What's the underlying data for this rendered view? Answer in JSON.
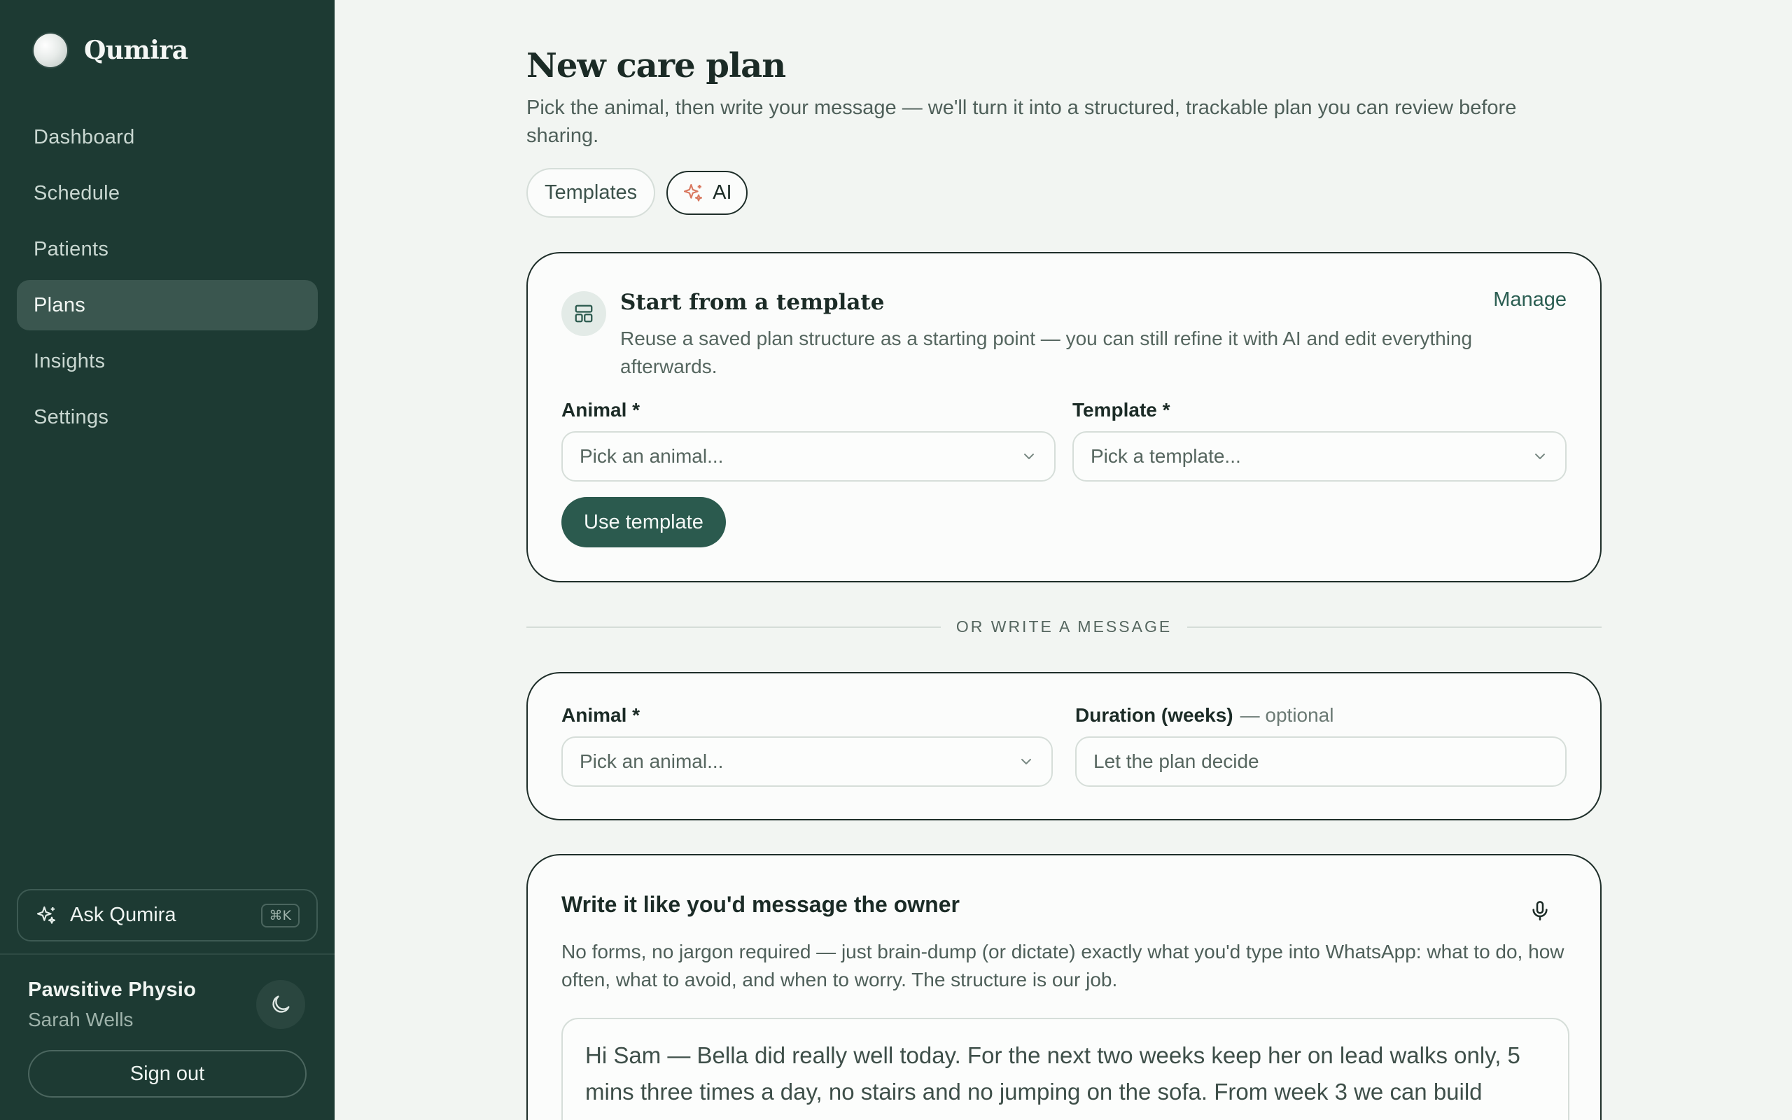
{
  "app": {
    "name": "Qumira"
  },
  "sidebar": {
    "items": [
      {
        "label": "Dashboard",
        "active": false
      },
      {
        "label": "Schedule",
        "active": false
      },
      {
        "label": "Patients",
        "active": false
      },
      {
        "label": "Plans",
        "active": true
      },
      {
        "label": "Insights",
        "active": false
      },
      {
        "label": "Settings",
        "active": false
      }
    ],
    "ask_label": "Ask Qumira",
    "ask_shortcut": "⌘K",
    "org_name": "Pawsitive Physio",
    "user_name": "Sarah Wells",
    "theme_icon": "moon-icon",
    "signout_label": "Sign out"
  },
  "page": {
    "title": "New care plan",
    "subtitle": "Pick the animal, then write your message — we'll turn it into a structured, trackable plan you can review before sharing.",
    "tabs": [
      {
        "label": "Templates",
        "active": false
      },
      {
        "label": "AI",
        "active": true,
        "icon": "sparkle-icon"
      }
    ]
  },
  "template_card": {
    "icon": "layout-icon",
    "title": "Start from a template",
    "description": "Reuse a saved plan structure as a starting point — you can still refine it with AI and edit everything afterwards.",
    "manage_label": "Manage",
    "animal_label": "Animal *",
    "animal_placeholder": "Pick an animal...",
    "template_label": "Template *",
    "template_placeholder": "Pick a template...",
    "button_label": "Use template"
  },
  "divider_text": "OR WRITE A MESSAGE",
  "animal_card": {
    "animal_label": "Animal *",
    "animal_placeholder": "Pick an animal...",
    "duration_label": "Duration (weeks)",
    "duration_optional": "— optional",
    "duration_placeholder": "Let the plan decide"
  },
  "message_card": {
    "title": "Write it like you'd message the owner",
    "description": "No forms, no jargon required — just brain-dump (or dictate) exactly what you'd type into WhatsApp: what to do, how often, what to avoid, and when to worry. The structure is our job.",
    "message_text": "Hi Sam — Bella did really well today. For the next two weeks keep her on lead walks only, 5 mins three times a day, no stairs and no jumping on the sofa. From week 3 we can build",
    "mic_icon": "microphone-icon"
  },
  "colors": {
    "sidebar_bg": "#1d3a33",
    "page_bg": "#f2f5f2",
    "primary": "#2b5a4e",
    "accent_spark": "#d9785f"
  }
}
